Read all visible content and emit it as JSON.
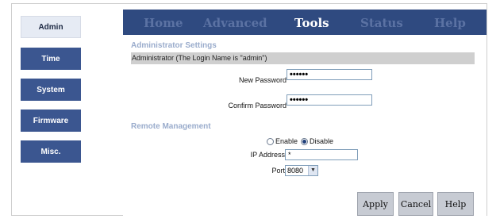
{
  "sidebar": {
    "items": [
      {
        "label": "Admin",
        "active": true
      },
      {
        "label": "Time",
        "active": false
      },
      {
        "label": "System",
        "active": false
      },
      {
        "label": "Firmware",
        "active": false
      },
      {
        "label": "Misc.",
        "active": false
      }
    ]
  },
  "nav": {
    "items": [
      {
        "label": "Home"
      },
      {
        "label": "Advanced"
      },
      {
        "label": "Tools",
        "active": true
      },
      {
        "label": "Status"
      },
      {
        "label": "Help"
      }
    ]
  },
  "admin": {
    "section_title": "Administrator Settings",
    "info": "Administrator (The Login Name is \"admin\")",
    "new_password_label": "New Password",
    "new_password_value": "••••••",
    "confirm_password_label": "Confirm Password",
    "confirm_password_value": "••••••"
  },
  "remote": {
    "section_title": "Remote Management",
    "enable_label": "Enable",
    "disable_label": "Disable",
    "selected": "Disable",
    "ip_label": "IP Address",
    "ip_value": "*",
    "port_label": "Port",
    "port_value": "8080"
  },
  "actions": {
    "apply": "Apply",
    "cancel": "Cancel",
    "help": "Help"
  },
  "colors": {
    "nav_bg": "#2f4a80",
    "sidebar_btn": "#3b5690",
    "section_title": "#9aaccc"
  }
}
